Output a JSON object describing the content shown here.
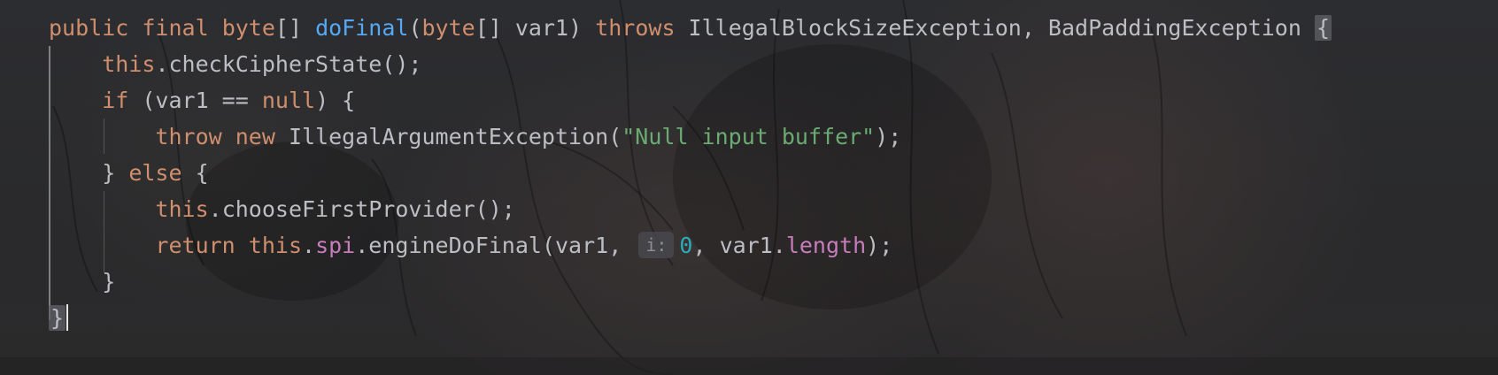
{
  "editor": {
    "lines": [
      {
        "tokens": [
          {
            "t": "public",
            "c": "kw"
          },
          {
            "t": " ",
            "c": "plain"
          },
          {
            "t": "final",
            "c": "kw"
          },
          {
            "t": " ",
            "c": "plain"
          },
          {
            "t": "byte",
            "c": "kw"
          },
          {
            "t": "[] ",
            "c": "plain"
          },
          {
            "t": "doFinal",
            "c": "fn"
          },
          {
            "t": "(",
            "c": "plain"
          },
          {
            "t": "byte",
            "c": "kw"
          },
          {
            "t": "[] var1) ",
            "c": "plain"
          },
          {
            "t": "throws",
            "c": "kw"
          },
          {
            "t": " IllegalBlockSizeException, BadPaddingException ",
            "c": "plain"
          },
          {
            "t": "{",
            "c": "brace"
          }
        ]
      },
      {
        "tokens": [
          {
            "t": "    ",
            "c": "plain"
          },
          {
            "t": "this",
            "c": "kw"
          },
          {
            "t": ".checkCipherState();",
            "c": "plain"
          }
        ]
      },
      {
        "tokens": [
          {
            "t": "    ",
            "c": "plain"
          },
          {
            "t": "if",
            "c": "kw"
          },
          {
            "t": " (var1 == ",
            "c": "plain"
          },
          {
            "t": "null",
            "c": "kw"
          },
          {
            "t": ") {",
            "c": "plain"
          }
        ]
      },
      {
        "tokens": [
          {
            "t": "        ",
            "c": "plain"
          },
          {
            "t": "throw",
            "c": "kw"
          },
          {
            "t": " ",
            "c": "plain"
          },
          {
            "t": "new",
            "c": "kw"
          },
          {
            "t": " IllegalArgumentException(",
            "c": "plain"
          },
          {
            "t": "\"Null input buffer\"",
            "c": "str"
          },
          {
            "t": ");",
            "c": "plain"
          }
        ]
      },
      {
        "tokens": [
          {
            "t": "    } ",
            "c": "plain"
          },
          {
            "t": "else",
            "c": "kw"
          },
          {
            "t": " {",
            "c": "plain"
          }
        ]
      },
      {
        "tokens": [
          {
            "t": "        ",
            "c": "plain"
          },
          {
            "t": "this",
            "c": "kw"
          },
          {
            "t": ".chooseFirstProvider();",
            "c": "plain"
          }
        ]
      },
      {
        "tokens": [
          {
            "t": "        ",
            "c": "plain"
          },
          {
            "t": "return",
            "c": "kw"
          },
          {
            "t": " ",
            "c": "plain"
          },
          {
            "t": "this",
            "c": "kw"
          },
          {
            "t": ".",
            "c": "plain"
          },
          {
            "t": "spi",
            "c": "fld"
          },
          {
            "t": ".engineDoFinal(var1, ",
            "c": "plain"
          },
          {
            "t": "i:",
            "c": "hint"
          },
          {
            "t": "0",
            "c": "num"
          },
          {
            "t": ", var1.",
            "c": "plain"
          },
          {
            "t": "length",
            "c": "fld"
          },
          {
            "t": ");",
            "c": "plain"
          }
        ]
      },
      {
        "tokens": [
          {
            "t": "    }",
            "c": "plain"
          }
        ]
      },
      {
        "tokens": [
          {
            "t": "}",
            "c": "brace"
          },
          {
            "t": "",
            "c": "caret"
          }
        ]
      }
    ],
    "colors": {
      "keyword": "#cf8e6d",
      "function": "#56a8f5",
      "string": "#6aab73",
      "field": "#c77dbb",
      "number": "#2aacb8",
      "text": "#bcbec4"
    }
  }
}
